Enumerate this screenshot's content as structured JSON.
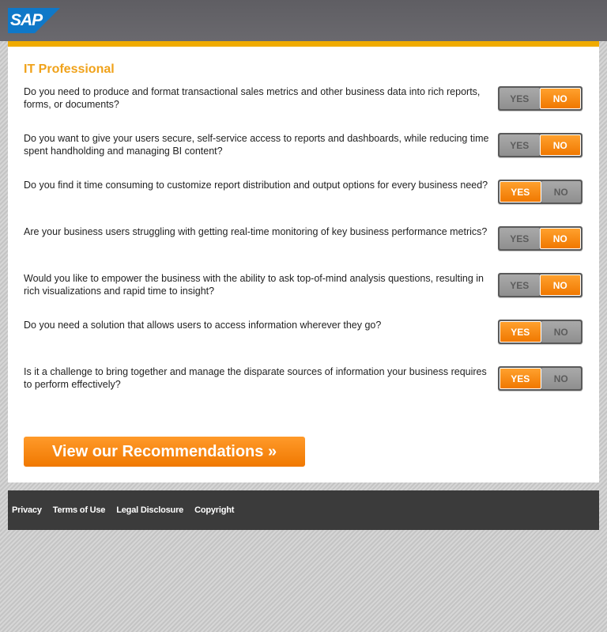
{
  "header": {
    "logo_text": "SAP",
    "logo_color": "#0f78c8"
  },
  "section": {
    "title": "IT Professional"
  },
  "questions": [
    {
      "text": "Do you need to produce and format transactional sales metrics and other business data into rich reports, forms, or documents?",
      "yes_label": "YES",
      "no_label": "NO",
      "selected": "NO"
    },
    {
      "text": "Do you want to give your users secure, self-service access to reports and dashboards, while reducing time spent handholding and managing BI content?",
      "yes_label": "YES",
      "no_label": "NO",
      "selected": "NO"
    },
    {
      "text": "Do you find it time consuming to customize report distribution and output options for every business need?",
      "yes_label": "YES",
      "no_label": "NO",
      "selected": "YES"
    },
    {
      "text": "Are your business users struggling with getting real-time monitoring of key business performance metrics?",
      "yes_label": "YES",
      "no_label": "NO",
      "selected": "NO"
    },
    {
      "text": "Would you like to empower the business with the ability to ask top-of-mind analysis questions, resulting in rich visualizations and rapid time to insight?",
      "yes_label": "YES",
      "no_label": "NO",
      "selected": "NO"
    },
    {
      "text": "Do you need a solution that allows users to access information wherever they go?",
      "yes_label": "YES",
      "no_label": "NO",
      "selected": "YES"
    },
    {
      "text": "Is it a challenge to bring together and manage the disparate sources of information your business requires to perform effectively?",
      "yes_label": "YES",
      "no_label": "NO",
      "selected": "YES"
    }
  ],
  "cta": {
    "label": "View our Recommendations »"
  },
  "footer": {
    "links": [
      "Privacy",
      "Terms of Use",
      "Legal Disclosure",
      "Copyright"
    ]
  },
  "colors": {
    "accent": "#f0ab00",
    "title": "#f0a21a",
    "toggle_on": "#f07800",
    "footer_bg": "#3b3b3b"
  }
}
